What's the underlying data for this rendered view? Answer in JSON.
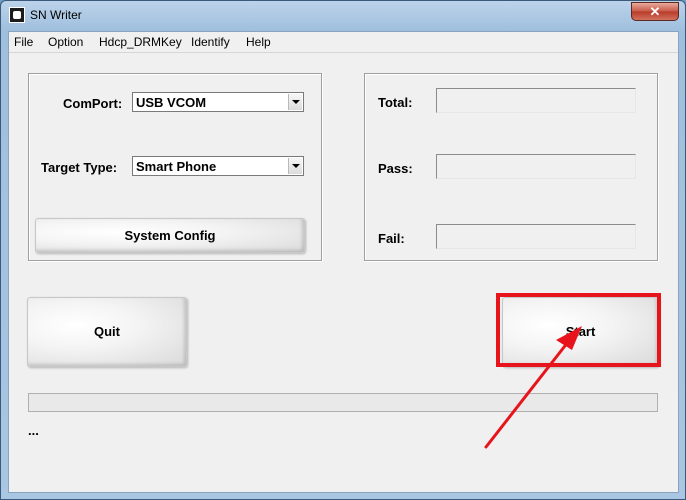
{
  "window": {
    "title": "SN Writer",
    "close_symbol": "✕"
  },
  "menu": {
    "items": [
      "File",
      "Option",
      "Hdcp_DRMKey",
      "Identify",
      "Help"
    ]
  },
  "settings": {
    "comport_label": "ComPort:",
    "comport_value": "USB VCOM",
    "target_type_label": "Target Type:",
    "target_type_value": "Smart Phone",
    "system_config_label": "System Config"
  },
  "stats": {
    "total_label": "Total:",
    "pass_label": "Pass:",
    "fail_label": "Fail:"
  },
  "actions": {
    "quit_label": "Quit",
    "start_label": "Start"
  },
  "status": {
    "progress": 0,
    "text": "..."
  },
  "colors": {
    "highlight": "#e8141b",
    "titlebar": "#a9c6e2",
    "client_bg": "#f0f0f0"
  },
  "icons": {
    "app": "sn-writer-app-icon",
    "annotation": "red-arrow-annotation"
  }
}
